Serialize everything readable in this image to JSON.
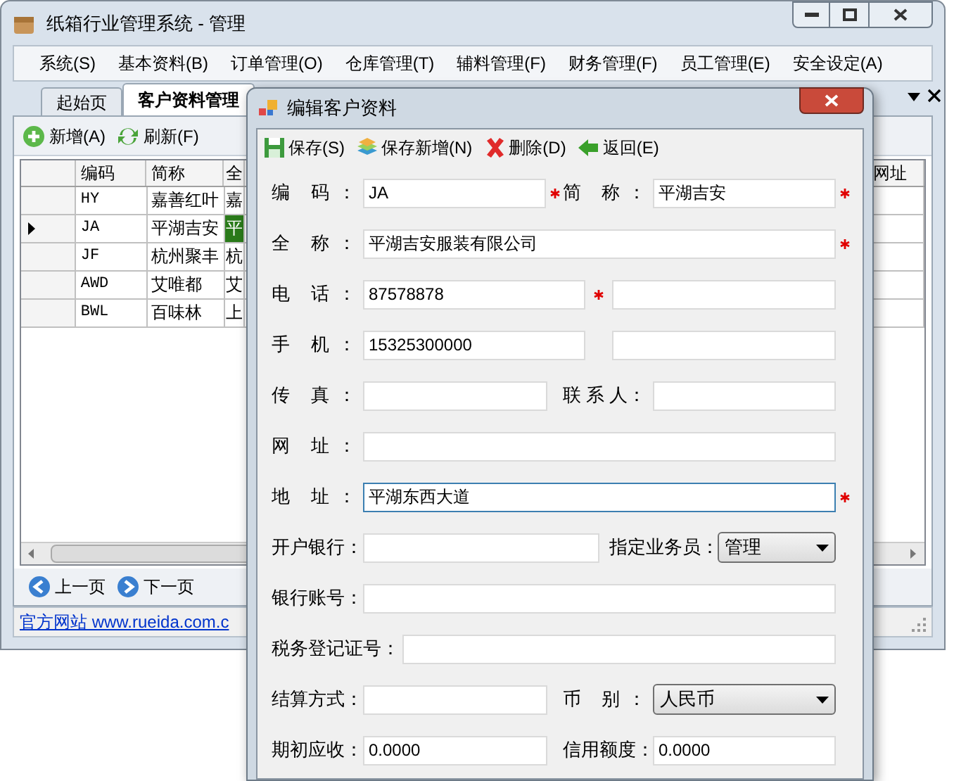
{
  "window": {
    "title": "纸箱行业管理系统 - 管理"
  },
  "menu": [
    "系统(S)",
    "基本资料(B)",
    "订单管理(O)",
    "仓库管理(T)",
    "辅料管理(F)",
    "财务管理(F)",
    "员工管理(E)",
    "安全设定(A)"
  ],
  "tabs": [
    {
      "label": "起始页",
      "selected": false
    },
    {
      "label": "客户资料管理",
      "selected": true
    }
  ],
  "toolbar": [
    {
      "label": "新增(A)",
      "kind": "add"
    },
    {
      "label": "刷新(F)",
      "kind": "refresh"
    }
  ],
  "grid": {
    "columns": [
      "编码",
      "简称",
      "全",
      "网址"
    ],
    "rows": [
      {
        "cells": [
          "HY",
          "嘉善红叶",
          "嘉"
        ],
        "selected": false
      },
      {
        "cells": [
          "JA",
          "平湖吉安",
          "平"
        ],
        "selected": true
      },
      {
        "cells": [
          "JF",
          "杭州聚丰",
          "杭"
        ],
        "selected": false
      },
      {
        "cells": [
          "AWD",
          "艾唯都",
          "艾"
        ],
        "selected": false
      },
      {
        "cells": [
          "BWL",
          "百味林",
          "上"
        ],
        "selected": false
      }
    ]
  },
  "pager": [
    {
      "label": "上一页",
      "kind": "prev"
    },
    {
      "label": "下一页",
      "kind": "next"
    }
  ],
  "status_link": "官方网站 www.rueida.com.c",
  "dialog": {
    "title": "编辑客户资料",
    "toolbar": [
      {
        "label": "保存(S)",
        "kind": "save"
      },
      {
        "label": "保存新增(N)",
        "kind": "save-new"
      },
      {
        "label": "删除(D)",
        "kind": "delete"
      },
      {
        "label": "返回(E)",
        "kind": "back"
      }
    ],
    "rows": [
      [
        {
          "label": "编 码：",
          "value": "JA",
          "required": true,
          "kind": "text",
          "focused": false
        },
        {
          "label": "简 称：",
          "value": "平湖吉安",
          "required": true,
          "kind": "text",
          "focused": false
        }
      ],
      [
        {
          "label": "全 称：",
          "value": "平湖吉安服装有限公司",
          "required": true,
          "kind": "text",
          "focused": false
        }
      ],
      [
        {
          "label": "电 话：",
          "value": "87578878",
          "required": true,
          "kind": "text",
          "focused": false
        },
        {
          "required": false,
          "kind": "text",
          "focused": false
        }
      ],
      [
        {
          "label": "手 机：",
          "value": "15325300000",
          "required": false,
          "kind": "text",
          "focused": false
        },
        {
          "required": false,
          "kind": "text",
          "focused": false
        }
      ],
      [
        {
          "label": "传 真：",
          "required": false,
          "kind": "text",
          "focused": false
        },
        {
          "label": "联 系 人：",
          "required": false,
          "kind": "text",
          "focused": false
        }
      ],
      [
        {
          "label": "网 址：",
          "required": false,
          "kind": "text",
          "focused": false
        }
      ],
      [
        {
          "label": "地 址：",
          "value": "平湖东西大道",
          "required": true,
          "kind": "text",
          "focused": true
        }
      ],
      [
        {
          "label": "开户银行：",
          "required": false,
          "kind": "text",
          "focused": false
        },
        {
          "label": "指定业务员：",
          "value": "管理",
          "required": false,
          "kind": "select",
          "focused": false
        }
      ],
      [
        {
          "label": "银行账号：",
          "required": false,
          "kind": "text",
          "focused": false
        }
      ],
      [
        {
          "label": "税务登记证号：",
          "required": false,
          "kind": "text",
          "focused": false
        }
      ],
      [
        {
          "label": "结算方式：",
          "required": false,
          "kind": "text",
          "focused": false
        },
        {
          "label": "币 别：",
          "value": "人民币",
          "required": false,
          "kind": "select",
          "focused": false
        }
      ],
      [
        {
          "label": "期初应收：",
          "value": "0.0000",
          "required": false,
          "kind": "text",
          "focused": false
        },
        {
          "label": "信用额度：",
          "value": "0.0000",
          "required": false,
          "kind": "text",
          "focused": false
        }
      ]
    ]
  }
}
